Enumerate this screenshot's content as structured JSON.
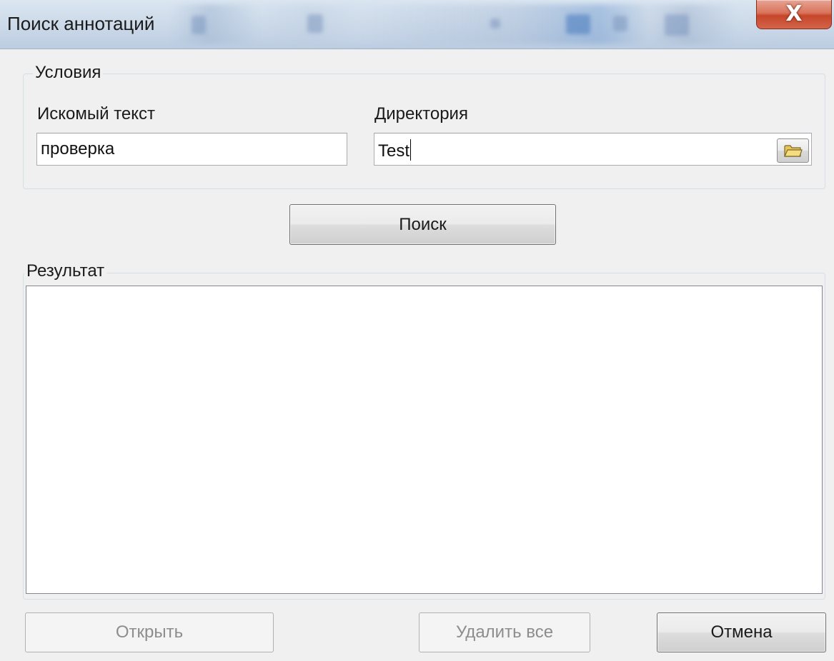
{
  "window": {
    "title": "Поиск аннотаций",
    "close_glyph": "X"
  },
  "conditions": {
    "group_title": "Условия",
    "search_text_label": "Искомый текст",
    "search_text_value": "проверка",
    "directory_label": "Директория",
    "directory_value": "Test",
    "browse_icon": "folder-icon"
  },
  "search_button_label": "Поиск",
  "results": {
    "group_title": "Результат",
    "items": []
  },
  "footer": {
    "open_label": "Открыть",
    "delete_all_label": "Удалить все",
    "cancel_label": "Отмена"
  },
  "colors": {
    "close_button": "#c7462a",
    "disabled_text": "#8d8d8d"
  }
}
